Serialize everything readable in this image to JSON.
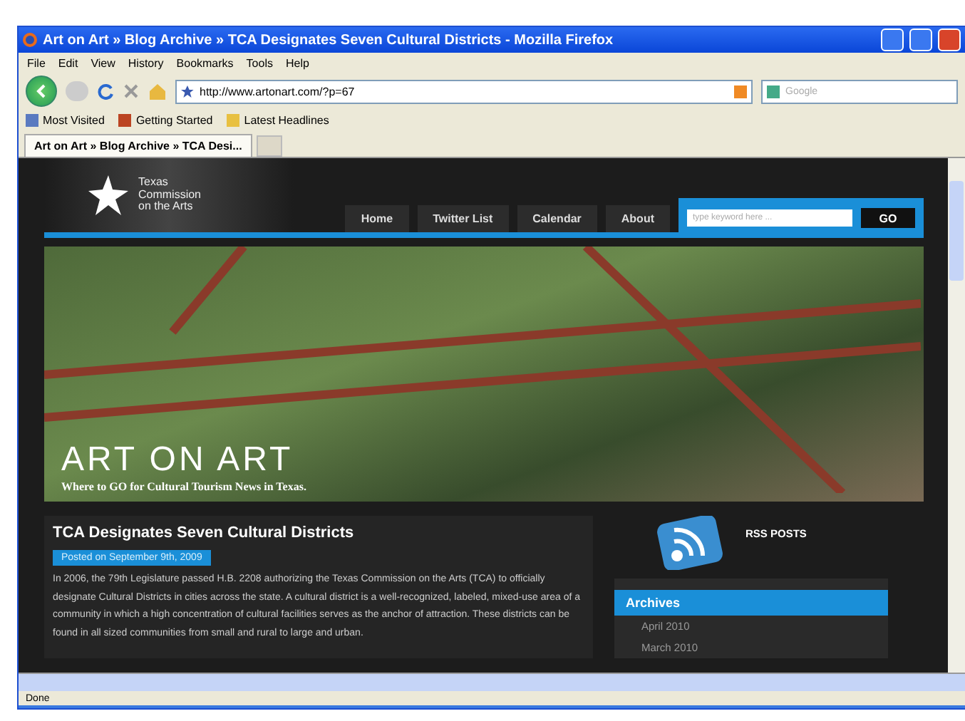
{
  "window": {
    "title": "Art on Art » Blog Archive » TCA Designates Seven Cultural Districts - Mozilla Firefox"
  },
  "menu": [
    "File",
    "Edit",
    "View",
    "History",
    "Bookmarks",
    "Tools",
    "Help"
  ],
  "address": {
    "value": "http://www.artonart.com/?p=67"
  },
  "search": {
    "placeholder": "Google"
  },
  "bookmarks": [
    "Most Visited",
    "Getting Started",
    "Latest Headlines"
  ],
  "tabs": [
    {
      "label": "Art on Art » Blog Archive » TCA Desi...",
      "selected": true
    }
  ],
  "page": {
    "logo": "Texas Commission on the Arts",
    "nav": [
      "Home",
      "Twitter List",
      "Calendar",
      "About"
    ],
    "site_search": {
      "placeholder": "type keyword here ...",
      "button": "GO"
    },
    "hero": {
      "title": "ART ON ART",
      "subtitle": "Where to GO for Cultural Tourism News in Texas."
    },
    "post": {
      "title": "TCA Designates Seven Cultural Districts",
      "date": "Posted on September 9th, 2009",
      "body": "In 2006, the 79th Legislature passed H.B. 2208 authorizing the Texas Commission on the Arts (TCA) to officially designate Cultural Districts in cities across the state. A cultural district is a well-recognized, labeled, mixed-use area of a community in which a high concentration of cultural facilities serves as the anchor of attraction. These districts can be found in all sized communities from small and rural to large and urban."
    },
    "rss": "RSS POSTS",
    "archives": {
      "title": "Archives",
      "items": [
        "April 2010",
        "March 2010"
      ]
    }
  },
  "status_bar": "Done"
}
